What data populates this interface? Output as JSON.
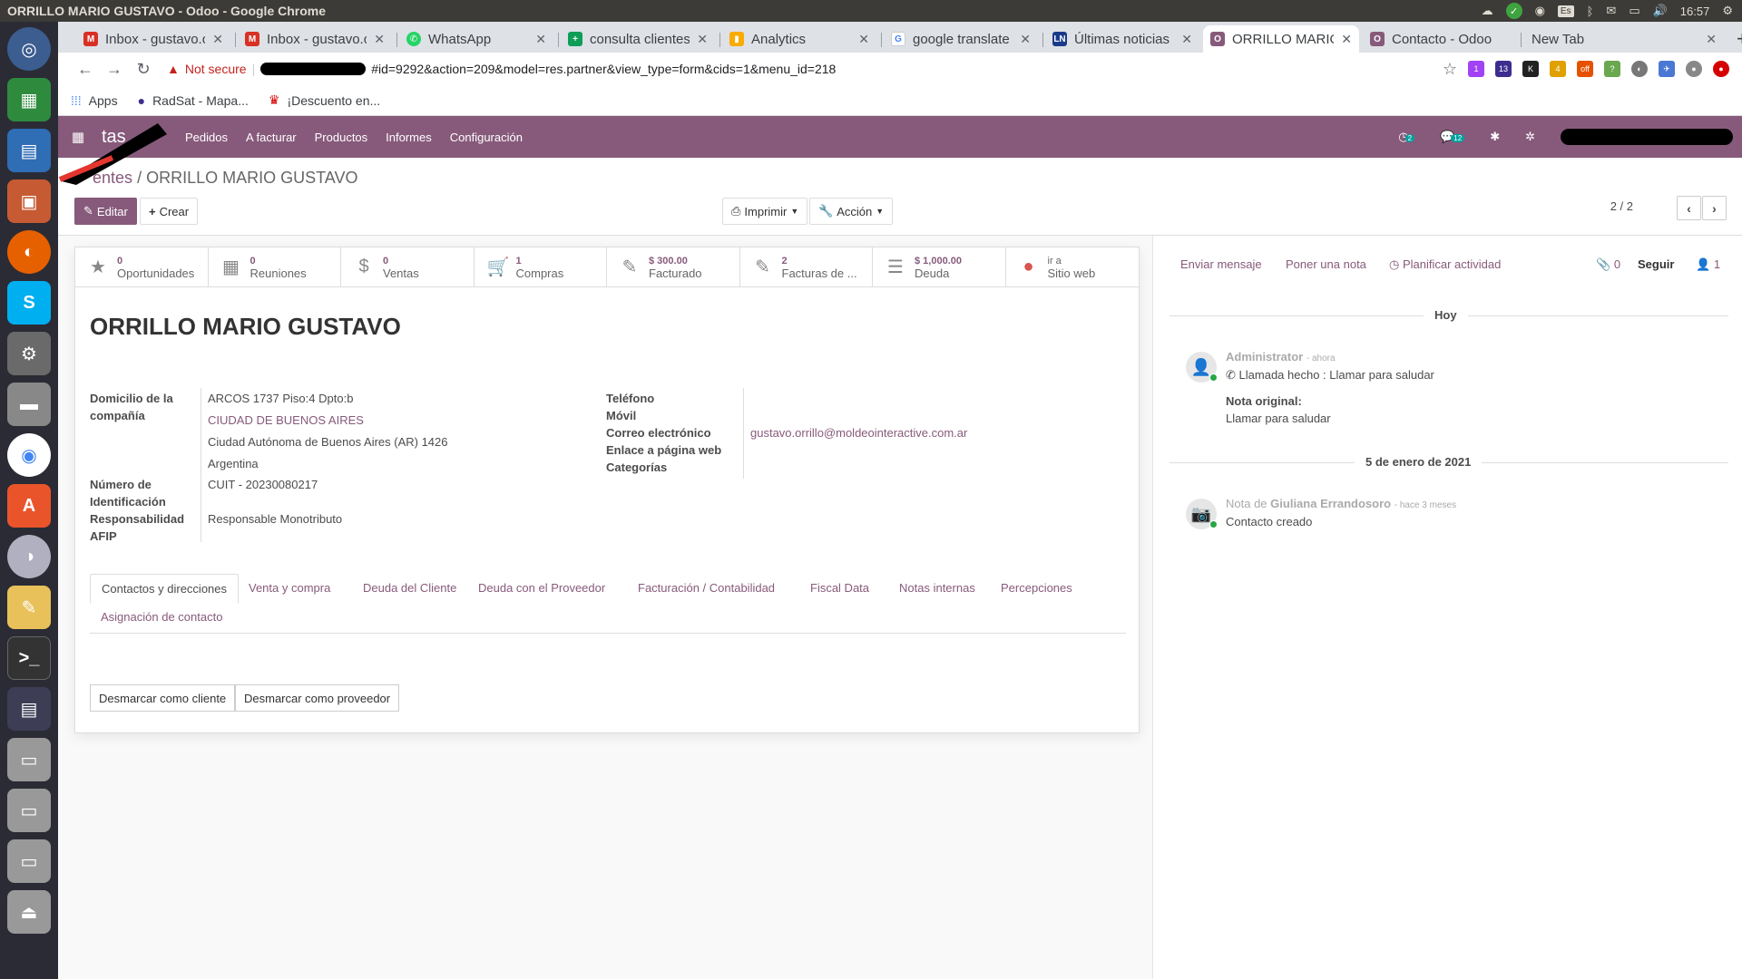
{
  "os": {
    "window_title": "ORRILLO MARIO GUSTAVO - Odoo - Google Chrome",
    "clock": "16:57",
    "keyboard_layout": "Es"
  },
  "browser": {
    "tabs": [
      {
        "label": "Inbox - gustavo.o",
        "icon": "gmail-icon",
        "color": "#d93025"
      },
      {
        "label": "Inbox - gustavo.o",
        "icon": "gmail-icon",
        "color": "#d93025"
      },
      {
        "label": "WhatsApp",
        "icon": "whatsapp-icon",
        "color": "#25d366"
      },
      {
        "label": "consulta clientes",
        "icon": "sheets-icon",
        "color": "#0f9d58"
      },
      {
        "label": "Analytics",
        "icon": "analytics-icon",
        "color": "#f9ab00"
      },
      {
        "label": "google translate",
        "icon": "google-icon",
        "color": "#4285f4"
      },
      {
        "label": "Últimas noticias",
        "icon": "news-icon",
        "color": "#1a3a8a"
      },
      {
        "label": "ORRILLO MARIO",
        "icon": "odoo-icon",
        "color": "#875a7b"
      },
      {
        "label": "Contacto - Odoo",
        "icon": "odoo-icon",
        "color": "#875a7b"
      },
      {
        "label": "New Tab",
        "icon": "",
        "color": "#dee1e6"
      }
    ],
    "security_label": "Not secure",
    "url": "#id=9292&action=209&model=res.partner&view_type=form&cids=1&menu_id=218",
    "bookmarks": [
      {
        "label": "Apps",
        "icon": "apps-grid-icon"
      },
      {
        "label": "RadSat - Mapa...",
        "icon": "globe-icon"
      },
      {
        "label": "¡Descuento en...",
        "icon": "crown-icon"
      }
    ]
  },
  "odoo": {
    "app_name": "tas",
    "menu": [
      "Pedidos",
      "A facturar",
      "Productos",
      "Informes",
      "Configuración"
    ],
    "activity_count": "2",
    "message_count": "12",
    "breadcrumb_parent": "entes",
    "breadcrumb_current": "ORRILLO MARIO GUSTAVO",
    "buttons": {
      "edit": "Editar",
      "create": "Crear",
      "print": "Imprimir",
      "action": "Acción"
    },
    "pager": "2 / 2",
    "stats": [
      {
        "value": "0",
        "label": "Oportunidades",
        "icon": "star-icon"
      },
      {
        "value": "0",
        "label": "Reuniones",
        "icon": "calendar-icon"
      },
      {
        "value": "0",
        "label": "Ventas",
        "icon": "dollar-icon"
      },
      {
        "value": "1",
        "label": "Compras",
        "icon": "cart-icon"
      },
      {
        "value": "$ 300.00",
        "label": "Facturado",
        "icon": "pencil-square-icon"
      },
      {
        "value": "2",
        "label": "Facturas de ...",
        "icon": "pencil-square-icon"
      },
      {
        "value": "$ 1,000.00",
        "label": "Deuda",
        "icon": "list-icon"
      },
      {
        "value": "ir a",
        "label": "Sitio web",
        "icon": "globe-icon"
      }
    ],
    "partner_name": "ORRILLO MARIO GUSTAVO",
    "left_fields": {
      "address_label": "Domicilio de la compañía",
      "street": "ARCOS 1737 Piso:4 Dpto:b",
      "city": "CIUDAD DE BUENOS AIRES",
      "state_zip": "Ciudad Autónoma de Buenos Aires (AR)  1426",
      "country": "Argentina",
      "id_label": "Número de Identificación",
      "id_value": "CUIT - 20230080217",
      "afip_label": "Responsabilidad AFIP",
      "afip_value": "Responsable Monotributo"
    },
    "right_fields": {
      "phone_label": "Teléfono",
      "mobile_label": "Móvil",
      "email_label": "Correo electrónico",
      "email_value": "gustavo.orrillo@moldeointeractive.com.ar",
      "web_label": "Enlace a página web",
      "categories_label": "Categorías"
    },
    "notebook_tabs": [
      "Contactos y direcciones",
      "Venta y compra",
      "Deuda del Cliente",
      "Deuda con el Proveedor",
      "Facturación / Contabilidad",
      "Fiscal Data",
      "Notas internas",
      "Percepciones",
      "Asignación de contacto"
    ],
    "sheet_buttons": {
      "unmark_customer": "Desmarcar como cliente",
      "unmark_vendor": "Desmarcar como proveedor"
    },
    "chatter": {
      "send_message": "Enviar mensaje",
      "log_note": "Poner una nota",
      "schedule_activity": "Planificar actividad",
      "attachments": "0",
      "follow": "Seguir",
      "followers": "1",
      "today_separator": "Hoy",
      "msg1_author": "Administrator",
      "msg1_time": "- ahora",
      "msg1_body": "Llamada hecho : Llamar para saludar",
      "msg1_note_label": "Nota original:",
      "msg1_note": "Llamar para saludar",
      "date_separator": "5 de enero de 2021",
      "msg2_prefix": "Nota de",
      "msg2_author": "Giuliana Errandosoro",
      "msg2_time": "- hace 3 meses",
      "msg2_body": "Contacto creado"
    }
  }
}
